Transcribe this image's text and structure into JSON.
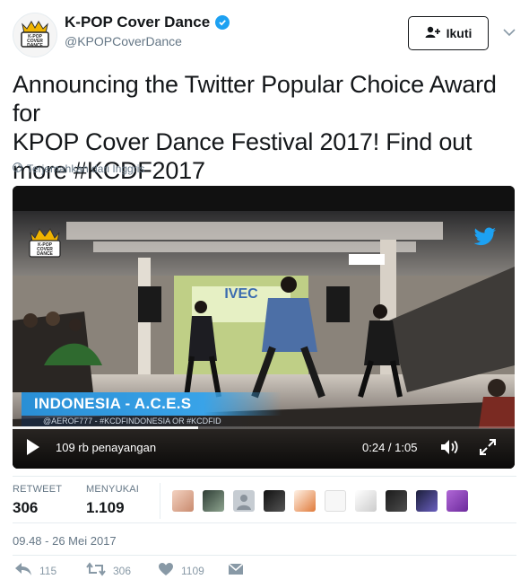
{
  "account": {
    "name": "K-POP Cover Dance",
    "handle": "@KPOPCoverDance",
    "avatar_text": [
      "K-POP",
      "COVER",
      "DANCE"
    ]
  },
  "follow_button": {
    "label": "Ikuti"
  },
  "tweet": {
    "text_line1": "Announcing the Twitter Popular Choice Award for",
    "text_line2": "KPOP Cover Dance Festival 2017! Find out",
    "text_line3_prefix": "more ",
    "hashtag": "#KCDF2017",
    "translate_label": "Terjemahkan dari Inggris"
  },
  "video": {
    "banner_title": "INDONESIA - A.C.E.S",
    "banner_subtitle": "@AEROF777 - #KCDFINDONESIA OR #KCDFID",
    "stage_sign": "IVEC",
    "views": "109 rb penayangan",
    "time": "0:24 / 1:05"
  },
  "stats": {
    "retweet_label": "RETWEET",
    "retweet_value": "306",
    "likes_label": "MENYUKAI",
    "likes_value": "1.109"
  },
  "timestamp": "09.48 - 26 Mei 2017",
  "actions": {
    "reply_count": "115",
    "retweet_count": "306",
    "like_count": "1109"
  },
  "colors": {
    "accent": "#1da1f2",
    "text": "#14171a",
    "muted": "#657786"
  },
  "icons": [
    "verified-icon",
    "add-user-icon",
    "chevron-down-icon",
    "globe-icon",
    "twitter-bird-icon",
    "play-icon",
    "volume-icon",
    "fullscreen-icon",
    "reply-icon",
    "retweet-icon",
    "heart-icon",
    "message-icon"
  ]
}
